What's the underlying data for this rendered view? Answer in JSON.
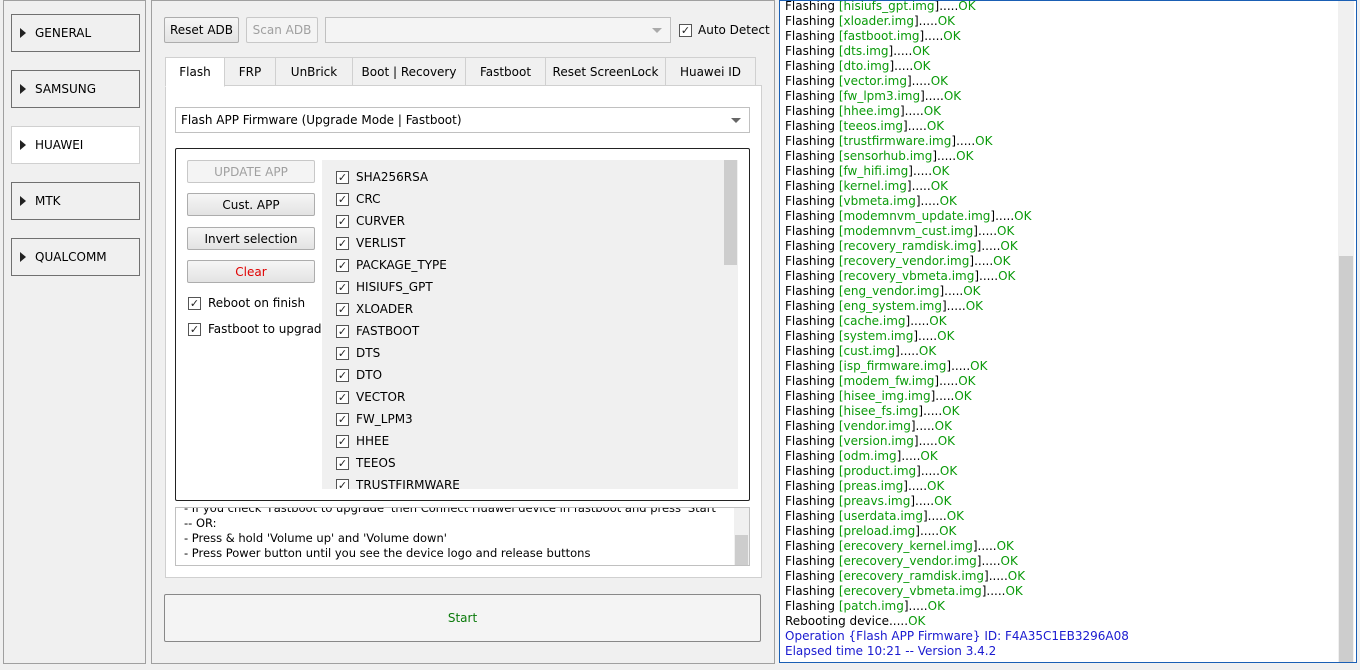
{
  "sidebar": {
    "items": [
      {
        "label": "GENERAL"
      },
      {
        "label": "SAMSUNG"
      },
      {
        "label": "HUAWEI",
        "selected": true
      },
      {
        "label": "MTK"
      },
      {
        "label": "QUALCOMM"
      }
    ]
  },
  "toolbar": {
    "reset_adb": "Reset ADB",
    "scan_adb": "Scan ADB",
    "port_value": "",
    "auto_detect": "Auto Detect",
    "auto_detect_checked": true
  },
  "tabs": [
    {
      "label": "Flash",
      "selected": true
    },
    {
      "label": "FRP"
    },
    {
      "label": "UnBrick"
    },
    {
      "label": "Boot | Recovery"
    },
    {
      "label": "Fastboot"
    },
    {
      "label": "Reset ScreenLock"
    },
    {
      "label": "Huawei ID"
    }
  ],
  "flash": {
    "mode": "Flash APP Firmware (Upgrade Mode | Fastboot)",
    "update_app": "UPDATE APP",
    "cust_app": "Cust. APP",
    "invert": "Invert selection",
    "clear": "Clear",
    "reboot_on_finish": "Reboot on finish",
    "fastboot_to_upgrade": "Fastboot to upgrade",
    "partitions": [
      "SHA256RSA",
      "CRC",
      "CURVER",
      "VERLIST",
      "PACKAGE_TYPE",
      "HISIUFS_GPT",
      "XLOADER",
      "FASTBOOT",
      "DTS",
      "DTO",
      "VECTOR",
      "FW_LPM3",
      "HHEE",
      "TEEOS",
      "TRUSTFIRMWARE"
    ],
    "instructions": [
      "- If you check 'Fastboot to upgrade' then Connect Huawei device in fastboot and press 'Start'",
      "-- OR:",
      "- Press & hold 'Volume up' and 'Volume down'",
      "- Press Power button until you see the device logo and release buttons"
    ],
    "start": "Start"
  },
  "colors": {
    "ok": "#0a9a0a",
    "info": "#1a1ad0",
    "clear": "#e00000"
  },
  "log": {
    "prefix": "Flashing ",
    "ok": "OK",
    "dots": ".....",
    "files": [
      "hisiufs_gpt.img",
      "xloader.img",
      "fastboot.img",
      "dts.img",
      "dto.img",
      "vector.img",
      "fw_lpm3.img",
      "hhee.img",
      "teeos.img",
      "trustfirmware.img",
      "sensorhub.img",
      "fw_hifi.img",
      "kernel.img",
      "vbmeta.img",
      "modemnvm_update.img",
      "modemnvm_cust.img",
      "recovery_ramdisk.img",
      "recovery_vendor.img",
      "recovery_vbmeta.img",
      "eng_vendor.img",
      "eng_system.img",
      "cache.img",
      "system.img",
      "cust.img",
      "isp_firmware.img",
      "modem_fw.img",
      "hisee_img.img",
      "hisee_fs.img",
      "vendor.img",
      "version.img",
      "odm.img",
      "product.img",
      "preas.img",
      "preavs.img",
      "userdata.img",
      "preload.img",
      "erecovery_kernel.img",
      "erecovery_vendor.img",
      "erecovery_ramdisk.img",
      "erecovery_vbmeta.img",
      "patch.img"
    ],
    "reboot": "Rebooting device",
    "operation": "Operation {Flash APP Firmware} ID: F4A35C1EB3296A08",
    "elapsed": "Elapsed time 10:21 -- Version 3.4.2"
  }
}
